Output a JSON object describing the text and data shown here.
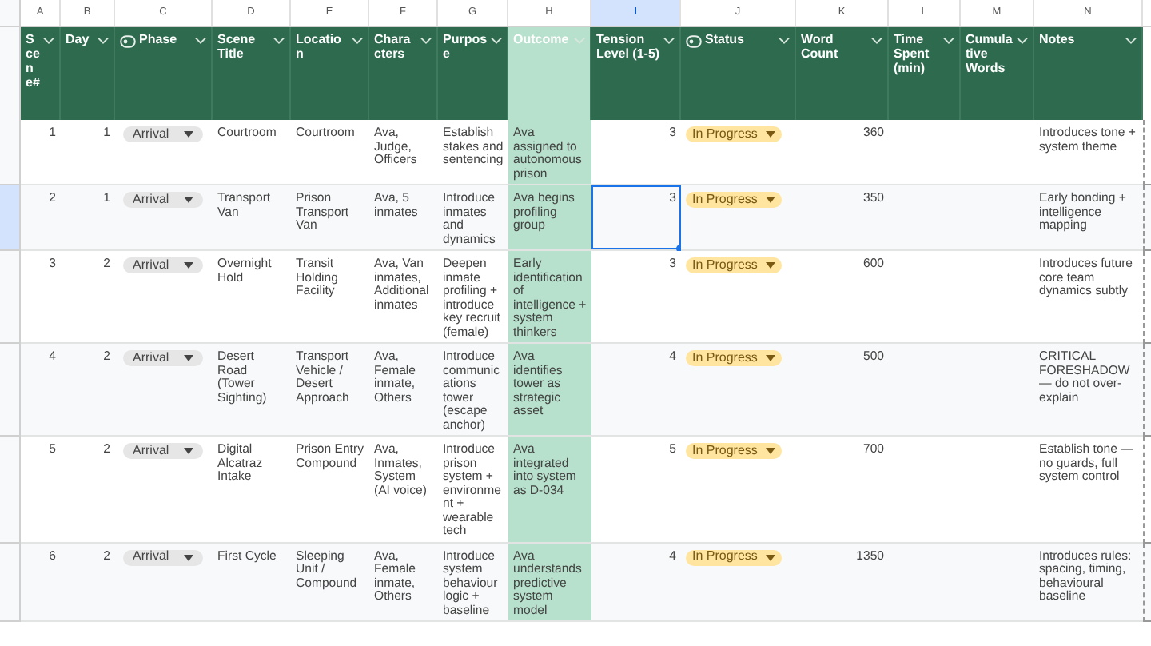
{
  "columns": [
    {
      "letter": "A",
      "header": "Scene#",
      "kind": "number",
      "selected": false,
      "highlighted": false
    },
    {
      "letter": "B",
      "header": "Day",
      "kind": "number",
      "selected": false,
      "highlighted": false
    },
    {
      "letter": "C",
      "header": "Phase",
      "kind": "phase",
      "selected": false,
      "highlighted": false
    },
    {
      "letter": "D",
      "header": "Scene Title",
      "kind": "text",
      "selected": false,
      "highlighted": false
    },
    {
      "letter": "E",
      "header": "Location",
      "kind": "text",
      "selected": false,
      "highlighted": false
    },
    {
      "letter": "F",
      "header": "Characters",
      "kind": "text",
      "selected": false,
      "highlighted": false
    },
    {
      "letter": "G",
      "header": "Purpose",
      "kind": "text",
      "selected": false,
      "highlighted": false
    },
    {
      "letter": "H",
      "header": "Outcome",
      "kind": "text",
      "selected": false,
      "highlighted": true
    },
    {
      "letter": "I",
      "header": "Tension Level (1-5)",
      "kind": "number",
      "selected": true,
      "highlighted": false
    },
    {
      "letter": "J",
      "header": "Status",
      "kind": "status",
      "selected": false,
      "highlighted": false
    },
    {
      "letter": "K",
      "header": "Word Count",
      "kind": "number",
      "selected": false,
      "highlighted": false
    },
    {
      "letter": "L",
      "header": "Time Spent (min)",
      "kind": "text",
      "selected": false,
      "highlighted": false
    },
    {
      "letter": "M",
      "header": "Cumulative Words",
      "kind": "text",
      "selected": false,
      "highlighted": false
    },
    {
      "letter": "N",
      "header": "Notes",
      "kind": "text",
      "selected": false,
      "highlighted": false
    }
  ],
  "rows": [
    {
      "selected": false,
      "values": {
        "A": "1",
        "B": "1",
        "C": "Arrival",
        "D": "Courtroom",
        "E": "Courtroom",
        "F": "Ava, Judge, Officers",
        "G": "Establish stakes and sentencing",
        "H": "Ava assigned to autonomous prison",
        "I": "3",
        "J": "In Progress",
        "K": "360",
        "N": "Introduces tone + system theme"
      }
    },
    {
      "selected": true,
      "values": {
        "A": "2",
        "B": "1",
        "C": "Arrival",
        "D": "Transport Van",
        "E": "Prison Transport Van",
        "F": "Ava, 5 inmates",
        "G": "Introduce inmates and dynamics",
        "H": "Ava begins profiling group",
        "I": "3",
        "J": "In Progress",
        "K": "350",
        "N": "Early bonding + intelligence mapping"
      }
    },
    {
      "selected": false,
      "values": {
        "A": "3",
        "B": "2",
        "C": "Arrival",
        "D": "Overnight Hold",
        "E": "Transit Holding Facility",
        "F": "Ava, Van inmates, Additional inmates",
        "G": "Deepen inmate profiling + introduce key recruit (female)",
        "H": "Early identification of intelligence + system thinkers",
        "I": "3",
        "J": "In Progress",
        "K": "600",
        "N": "Introduces future core team dynamics subtly"
      }
    },
    {
      "selected": false,
      "values": {
        "A": "4",
        "B": "2",
        "C": "Arrival",
        "D": "Desert Road (Tower Sighting)",
        "E": "Transport Vehicle / Desert Approach",
        "F": "Ava, Female inmate, Others",
        "G": "Introduce communications tower (escape anchor)",
        "H": "Ava identifies tower as strategic asset",
        "I": "4",
        "J": "In Progress",
        "K": "500",
        "N": "CRITICAL FORESHADOW — do not over-explain"
      }
    },
    {
      "selected": false,
      "values": {
        "A": "5",
        "B": "2",
        "C": "Arrival",
        "D": "Digital Alcatraz Intake",
        "E": "Prison Entry Compound",
        "F": "Ava, Inmates, System (AI voice)",
        "G": "Introduce prison system + environment + wearable tech",
        "H": "Ava integrated into system as D-034",
        "I": "5",
        "J": "In Progress",
        "K": "700",
        "N": "Establish tone — no guards, full system control"
      }
    },
    {
      "selected": false,
      "values": {
        "A": "6",
        "B": "2",
        "C": "Arrival",
        "D": "First Cycle",
        "E": "Sleeping Unit / Compound",
        "F": "Ava, Female inmate, Others",
        "G": "Introduce system behaviour logic + baseline",
        "H": "Ava understands predictive system model",
        "I": "4",
        "J": "In Progress",
        "K": "1350",
        "N": "Introduces rules: spacing, timing, behavioural baseline"
      }
    }
  ]
}
